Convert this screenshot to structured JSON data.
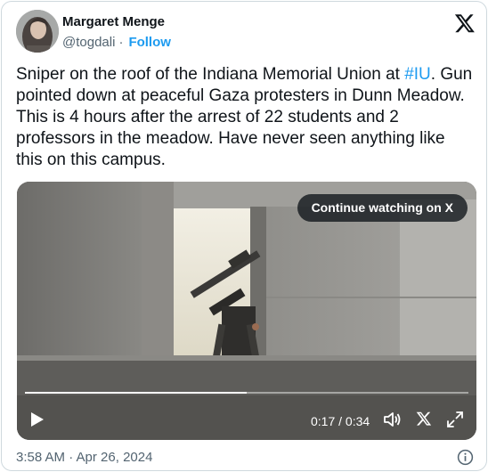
{
  "author": {
    "name": "Margaret Menge",
    "handle": "@togdali",
    "separator": "·",
    "follow_label": "Follow"
  },
  "tweet": {
    "text_before_hashtag": "Sniper on the roof of the Indiana Memorial Union at ",
    "hashtag": "#IU",
    "text_after_hashtag": ". Gun pointed down at peaceful Gaza protesters in Dunn Meadow. This is 4 hours after the arrest of 22 students and 2 professors in the meadow. Have never seen anything like this on this campus."
  },
  "video": {
    "continue_label": "Continue watching on X",
    "time_display": "0:17 / 0:34",
    "progress_fraction": 0.5
  },
  "footer": {
    "timestamp": "3:58 AM · Apr 26, 2024"
  },
  "icons": {
    "brand": "x-logo-icon",
    "play": "play-icon",
    "volume": "volume-icon",
    "fullscreen": "expand-icon",
    "info": "info-icon"
  },
  "colors": {
    "link": "#1d9bf0",
    "text": "#0f1419",
    "secondary": "#536471",
    "border": "#cfd9de"
  }
}
